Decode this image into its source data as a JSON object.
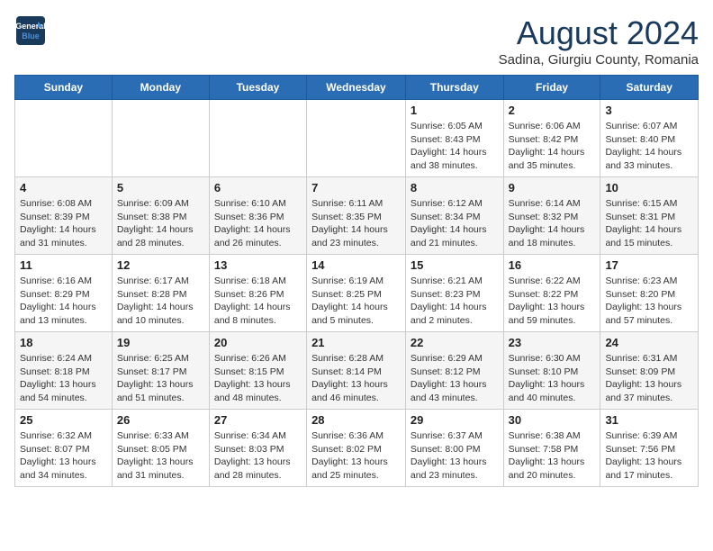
{
  "logo": {
    "line1": "General",
    "line2": "Blue"
  },
  "title": "August 2024",
  "location": "Sadina, Giurgiu County, Romania",
  "days_of_week": [
    "Sunday",
    "Monday",
    "Tuesday",
    "Wednesday",
    "Thursday",
    "Friday",
    "Saturday"
  ],
  "weeks": [
    [
      {
        "day": "",
        "info": ""
      },
      {
        "day": "",
        "info": ""
      },
      {
        "day": "",
        "info": ""
      },
      {
        "day": "",
        "info": ""
      },
      {
        "day": "1",
        "info": "Sunrise: 6:05 AM\nSunset: 8:43 PM\nDaylight: 14 hours\nand 38 minutes."
      },
      {
        "day": "2",
        "info": "Sunrise: 6:06 AM\nSunset: 8:42 PM\nDaylight: 14 hours\nand 35 minutes."
      },
      {
        "day": "3",
        "info": "Sunrise: 6:07 AM\nSunset: 8:40 PM\nDaylight: 14 hours\nand 33 minutes."
      }
    ],
    [
      {
        "day": "4",
        "info": "Sunrise: 6:08 AM\nSunset: 8:39 PM\nDaylight: 14 hours\nand 31 minutes."
      },
      {
        "day": "5",
        "info": "Sunrise: 6:09 AM\nSunset: 8:38 PM\nDaylight: 14 hours\nand 28 minutes."
      },
      {
        "day": "6",
        "info": "Sunrise: 6:10 AM\nSunset: 8:36 PM\nDaylight: 14 hours\nand 26 minutes."
      },
      {
        "day": "7",
        "info": "Sunrise: 6:11 AM\nSunset: 8:35 PM\nDaylight: 14 hours\nand 23 minutes."
      },
      {
        "day": "8",
        "info": "Sunrise: 6:12 AM\nSunset: 8:34 PM\nDaylight: 14 hours\nand 21 minutes."
      },
      {
        "day": "9",
        "info": "Sunrise: 6:14 AM\nSunset: 8:32 PM\nDaylight: 14 hours\nand 18 minutes."
      },
      {
        "day": "10",
        "info": "Sunrise: 6:15 AM\nSunset: 8:31 PM\nDaylight: 14 hours\nand 15 minutes."
      }
    ],
    [
      {
        "day": "11",
        "info": "Sunrise: 6:16 AM\nSunset: 8:29 PM\nDaylight: 14 hours\nand 13 minutes."
      },
      {
        "day": "12",
        "info": "Sunrise: 6:17 AM\nSunset: 8:28 PM\nDaylight: 14 hours\nand 10 minutes."
      },
      {
        "day": "13",
        "info": "Sunrise: 6:18 AM\nSunset: 8:26 PM\nDaylight: 14 hours\nand 8 minutes."
      },
      {
        "day": "14",
        "info": "Sunrise: 6:19 AM\nSunset: 8:25 PM\nDaylight: 14 hours\nand 5 minutes."
      },
      {
        "day": "15",
        "info": "Sunrise: 6:21 AM\nSunset: 8:23 PM\nDaylight: 14 hours\nand 2 minutes."
      },
      {
        "day": "16",
        "info": "Sunrise: 6:22 AM\nSunset: 8:22 PM\nDaylight: 13 hours\nand 59 minutes."
      },
      {
        "day": "17",
        "info": "Sunrise: 6:23 AM\nSunset: 8:20 PM\nDaylight: 13 hours\nand 57 minutes."
      }
    ],
    [
      {
        "day": "18",
        "info": "Sunrise: 6:24 AM\nSunset: 8:18 PM\nDaylight: 13 hours\nand 54 minutes."
      },
      {
        "day": "19",
        "info": "Sunrise: 6:25 AM\nSunset: 8:17 PM\nDaylight: 13 hours\nand 51 minutes."
      },
      {
        "day": "20",
        "info": "Sunrise: 6:26 AM\nSunset: 8:15 PM\nDaylight: 13 hours\nand 48 minutes."
      },
      {
        "day": "21",
        "info": "Sunrise: 6:28 AM\nSunset: 8:14 PM\nDaylight: 13 hours\nand 46 minutes."
      },
      {
        "day": "22",
        "info": "Sunrise: 6:29 AM\nSunset: 8:12 PM\nDaylight: 13 hours\nand 43 minutes."
      },
      {
        "day": "23",
        "info": "Sunrise: 6:30 AM\nSunset: 8:10 PM\nDaylight: 13 hours\nand 40 minutes."
      },
      {
        "day": "24",
        "info": "Sunrise: 6:31 AM\nSunset: 8:09 PM\nDaylight: 13 hours\nand 37 minutes."
      }
    ],
    [
      {
        "day": "25",
        "info": "Sunrise: 6:32 AM\nSunset: 8:07 PM\nDaylight: 13 hours\nand 34 minutes."
      },
      {
        "day": "26",
        "info": "Sunrise: 6:33 AM\nSunset: 8:05 PM\nDaylight: 13 hours\nand 31 minutes."
      },
      {
        "day": "27",
        "info": "Sunrise: 6:34 AM\nSunset: 8:03 PM\nDaylight: 13 hours\nand 28 minutes."
      },
      {
        "day": "28",
        "info": "Sunrise: 6:36 AM\nSunset: 8:02 PM\nDaylight: 13 hours\nand 25 minutes."
      },
      {
        "day": "29",
        "info": "Sunrise: 6:37 AM\nSunset: 8:00 PM\nDaylight: 13 hours\nand 23 minutes."
      },
      {
        "day": "30",
        "info": "Sunrise: 6:38 AM\nSunset: 7:58 PM\nDaylight: 13 hours\nand 20 minutes."
      },
      {
        "day": "31",
        "info": "Sunrise: 6:39 AM\nSunset: 7:56 PM\nDaylight: 13 hours\nand 17 minutes."
      }
    ]
  ]
}
